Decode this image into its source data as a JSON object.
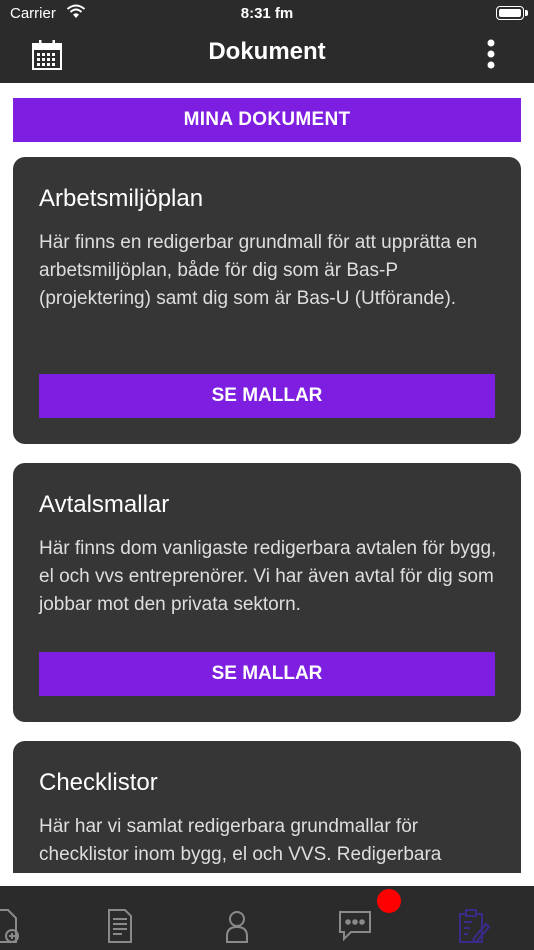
{
  "status_bar": {
    "carrier": "Carrier",
    "time": "8:31 fm"
  },
  "nav_bar": {
    "title": "Dokument",
    "left_icon": "calendar-icon",
    "right_icon": "more-vertical-icon"
  },
  "main": {
    "mina_dokument_label": "MINA DOKUMENT",
    "cards": [
      {
        "title": "Arbetsmiljöplan",
        "text": "Här finns en redigerbar grundmall för att upprätta en arbetsmiljöplan, både för dig som är Bas-P (projektering) samt dig som är Bas-U (Utförande).",
        "button": "SE MALLAR"
      },
      {
        "title": "Avtalsmallar",
        "text": "Här finns dom vanligaste redigerbara avtalen för bygg, el och vvs entreprenörer. Vi har även avtal för dig som jobbar mot den privata sektorn.",
        "button": "SE MALLAR"
      },
      {
        "title": "Checklistor",
        "text": "Här har vi samlat redigerbara grundmallar för checklistor inom bygg, el och VVS. Redigerbara"
      }
    ]
  },
  "tab_bar": {
    "tabs": [
      "document-add-icon",
      "document-icon",
      "person-icon",
      "chat-icon",
      "clipboard-icon"
    ],
    "active_index": 4,
    "badge_color": "#ff0000"
  },
  "colors": {
    "bar_background": "#2b2b2b",
    "card_background": "#363636",
    "accent": "#7d1ee0"
  }
}
